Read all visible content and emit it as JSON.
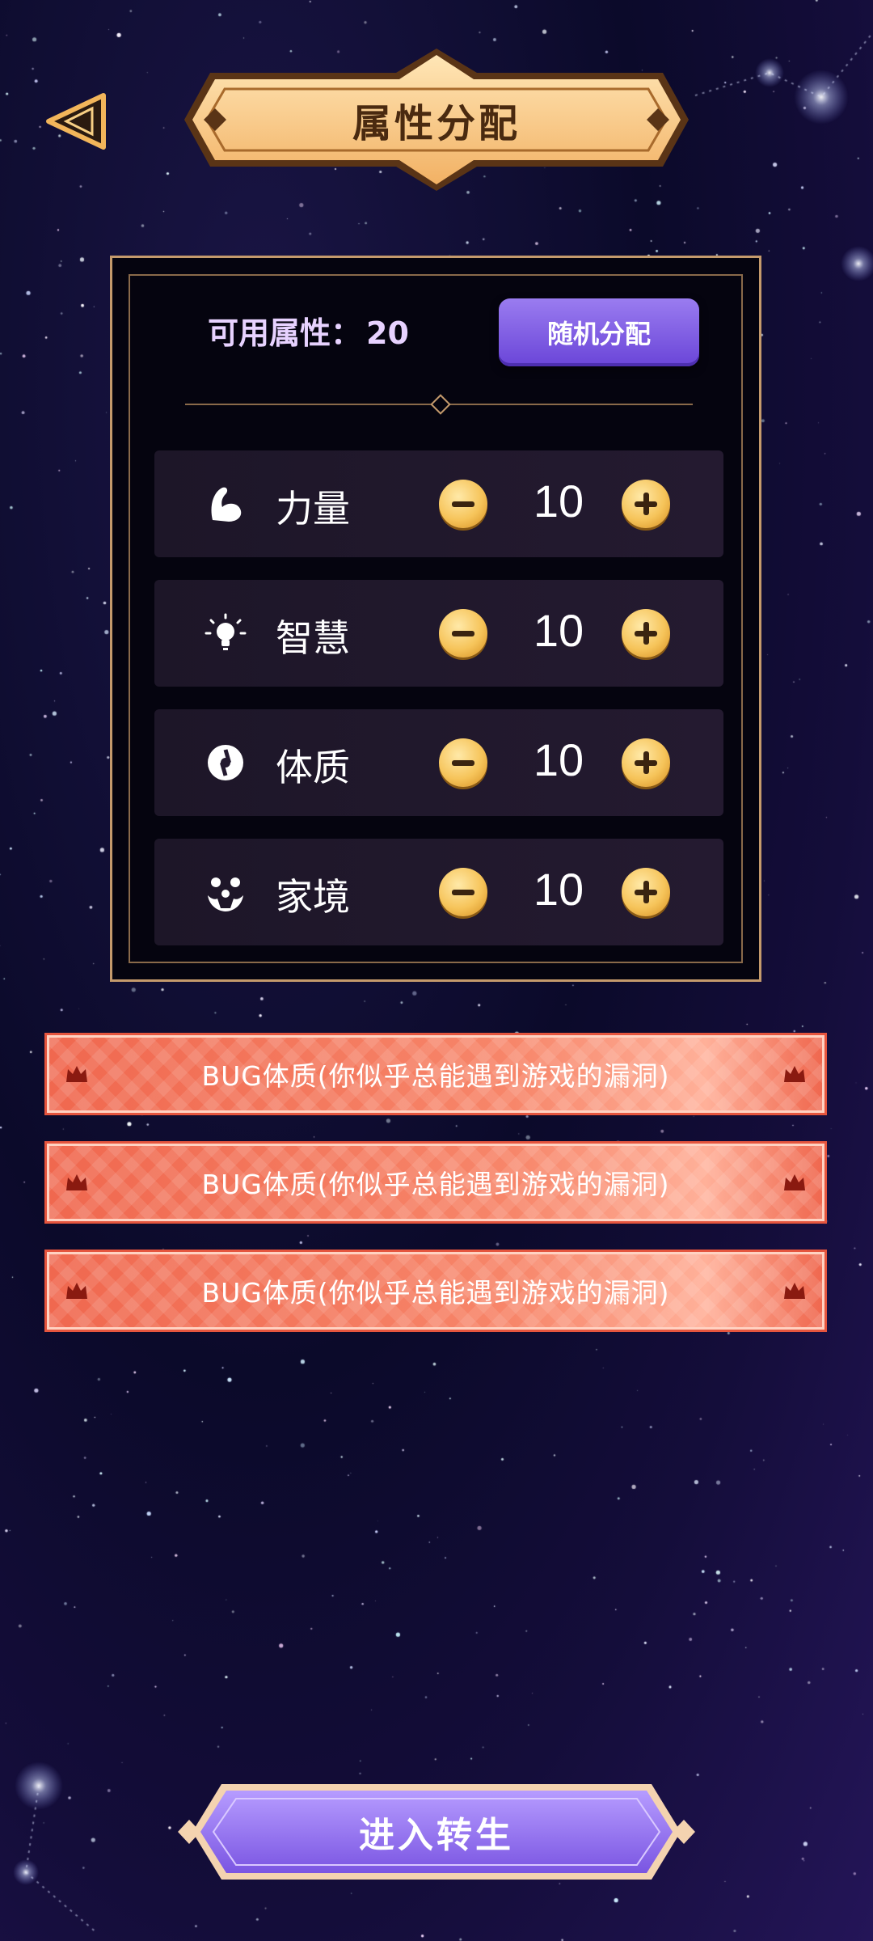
{
  "header": {
    "title": "属性分配",
    "back_icon": "back-triangle-icon"
  },
  "panel": {
    "available_label": "可用属性：",
    "available_points": "20",
    "random_button": "随机分配",
    "attributes": [
      {
        "name": "力量",
        "value": "10",
        "icon": "muscle-icon"
      },
      {
        "name": "智慧",
        "value": "10",
        "icon": "lightbulb-icon"
      },
      {
        "name": "体质",
        "value": "10",
        "icon": "body-icon"
      },
      {
        "name": "家境",
        "value": "10",
        "icon": "family-icon"
      }
    ]
  },
  "talents": [
    {
      "text": "BUG体质(你似乎总能遇到游戏的漏洞)"
    },
    {
      "text": "BUG体质(你似乎总能遇到游戏的漏洞)"
    },
    {
      "text": "BUG体质(你似乎总能遇到游戏的漏洞)"
    }
  ],
  "footer": {
    "enter_button": "进入转生"
  },
  "colors": {
    "title_banner": "#f7c98a",
    "panel_border": "#c49a6c",
    "random_button": "#7a58e0",
    "talent_banner": "#f0684f",
    "enter_button": "#8a6ae8"
  }
}
